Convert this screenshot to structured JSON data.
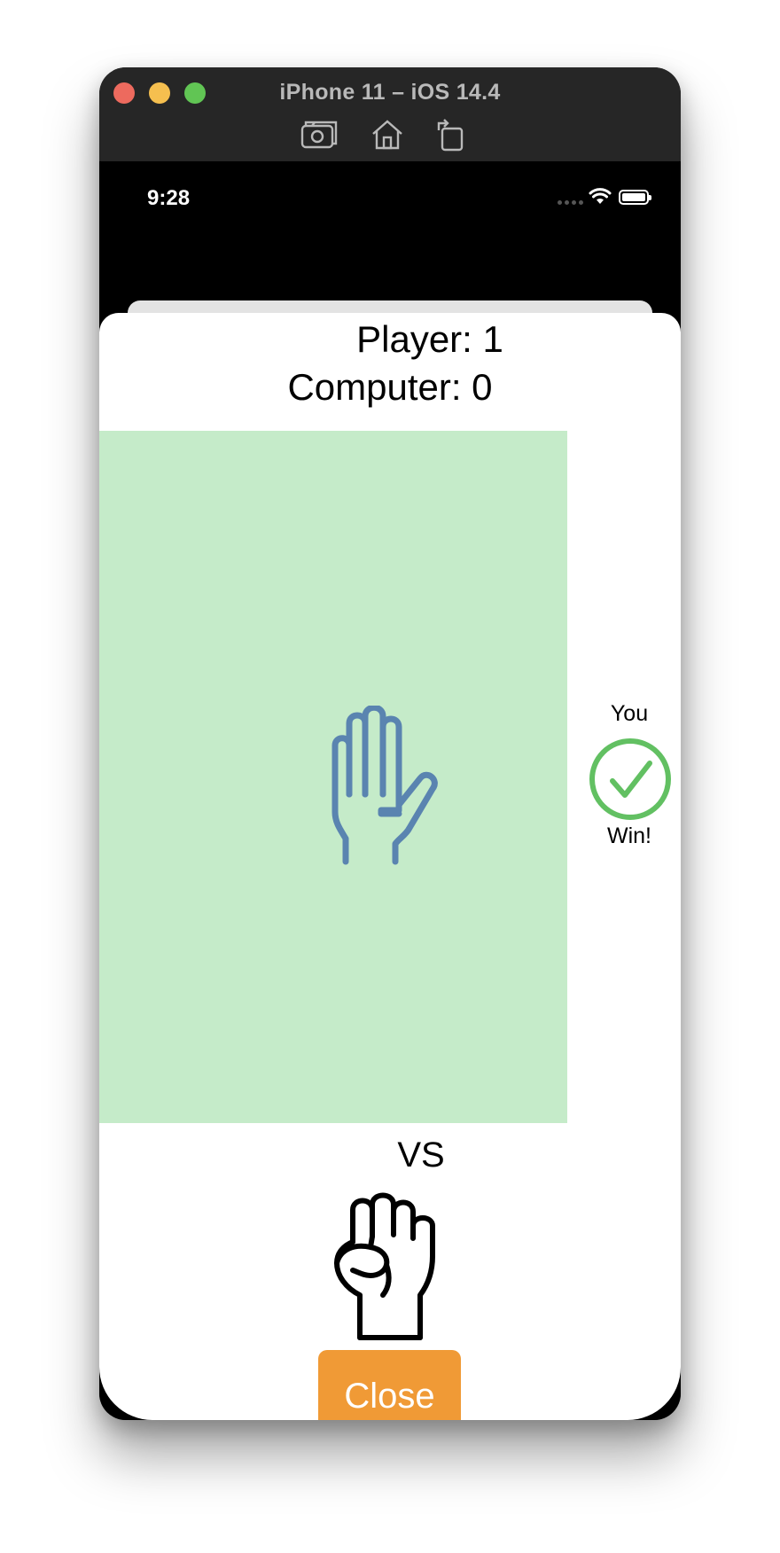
{
  "window": {
    "title": "iPhone 11 – iOS 14.4",
    "toolbar_icons": [
      "screenshot-icon",
      "home-icon",
      "rotate-icon"
    ]
  },
  "status_bar": {
    "time": "9:28"
  },
  "score": {
    "player": "Player: 1",
    "computer": "Computer: 0"
  },
  "player_choice": {
    "icon": "paper-hand-icon",
    "background": "#c5ebc9",
    "icon_color": "#5a84b0"
  },
  "result": {
    "top_text": "You",
    "bottom_text": "Win!",
    "icon": "checkmark-circle-icon",
    "color": "#62c062"
  },
  "vs_label": "VS",
  "computer_choice": {
    "icon": "rock-fist-icon"
  },
  "close_button": {
    "label": "Close",
    "color": "#f09a36"
  }
}
